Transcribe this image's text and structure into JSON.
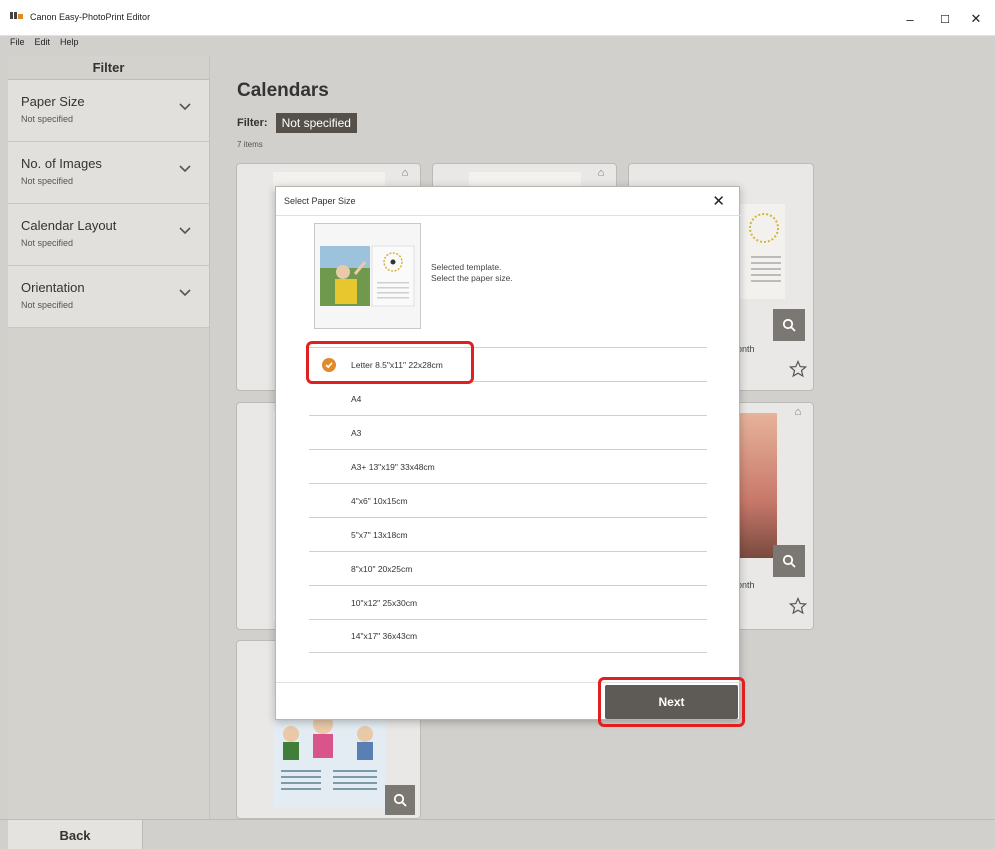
{
  "window": {
    "title": "Canon Easy-PhotoPrint Editor",
    "minimize_glyph": "–",
    "maximize_glyph": "☐",
    "close_glyph": "✕"
  },
  "menu": [
    "File",
    "Edit",
    "Help"
  ],
  "sidebar": {
    "header": "Filter",
    "items": [
      {
        "label": "Paper Size",
        "value": "Not specified"
      },
      {
        "label": "No. of Images",
        "value": "Not specified"
      },
      {
        "label": "Calendar Layout",
        "value": "Not specified"
      },
      {
        "label": "Orientation",
        "value": "Not specified"
      }
    ]
  },
  "main": {
    "title": "Calendars",
    "filter_label": "Filter:",
    "filter_value": "Not specified",
    "item_count": "7 items",
    "cards": [
      {
        "caption": "onth"
      },
      {
        "caption": "onth"
      }
    ]
  },
  "dialog": {
    "title": "Select Paper Size",
    "close_glyph": "✕",
    "note_line1": "Selected template.",
    "note_line2": "Select the paper size.",
    "sizes": [
      {
        "label": "Letter 8.5\"x11\" 22x28cm",
        "selected": true
      },
      {
        "label": "A4",
        "selected": false
      },
      {
        "label": "A3",
        "selected": false
      },
      {
        "label": "A3+ 13\"x19\" 33x48cm",
        "selected": false
      },
      {
        "label": "4\"x6\" 10x15cm",
        "selected": false
      },
      {
        "label": "5\"x7\" 13x18cm",
        "selected": false
      },
      {
        "label": "8\"x10\" 20x25cm",
        "selected": false
      },
      {
        "label": "10\"x12\" 25x30cm",
        "selected": false
      },
      {
        "label": "14\"x17\" 36x43cm",
        "selected": false
      }
    ],
    "next_label": "Next"
  },
  "footer": {
    "back_label": "Back"
  },
  "colors": {
    "accent_check": "#e08a2c",
    "highlight": "#e02020",
    "button_dark": "#5e5a55"
  }
}
